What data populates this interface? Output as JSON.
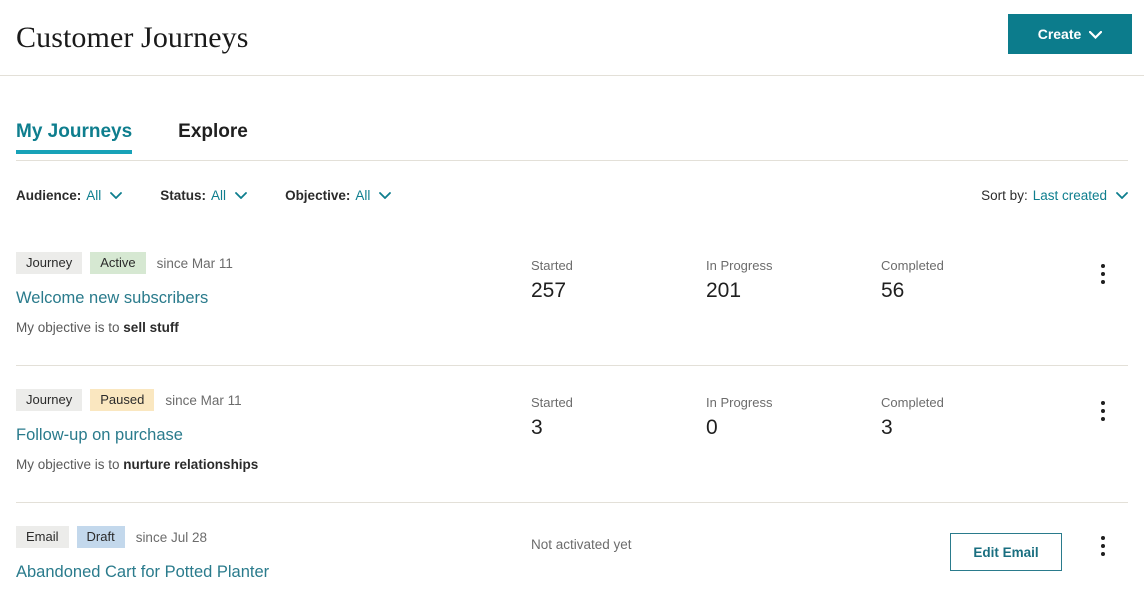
{
  "header": {
    "title": "Customer Journeys",
    "create_label": "Create",
    "create_caret": "∨",
    "create_color": "#0c7c8c"
  },
  "tabs": [
    {
      "label": "My Journeys",
      "active": true
    },
    {
      "label": "Explore",
      "active": false
    }
  ],
  "filters": [
    {
      "label": "Audience:",
      "value": "All",
      "caret": "∨"
    },
    {
      "label": "Status:",
      "value": "All",
      "caret": "∨"
    },
    {
      "label": "Objective:",
      "value": "All",
      "caret": "∨"
    }
  ],
  "sort": {
    "label": "Sort by:",
    "value": "Last created",
    "caret": "∨"
  },
  "stat_headers": {
    "started": "Started",
    "in_progress": "In Progress",
    "completed": "Completed"
  },
  "rows": [
    {
      "type_badge": "Journey",
      "status_badge": "Active",
      "status_kind": "active",
      "since": "since Mar 11",
      "title": "Welcome new subscribers",
      "objective_prefix": "My objective is to ",
      "objective": "sell stuff",
      "started": "257",
      "in_progress": "201",
      "completed": "56"
    },
    {
      "type_badge": "Journey",
      "status_badge": "Paused",
      "status_kind": "paused",
      "since": "since Mar 11",
      "title": "Follow-up on purchase",
      "objective_prefix": "My objective is to ",
      "objective": "nurture relationships",
      "started": "3",
      "in_progress": "0",
      "completed": "3"
    },
    {
      "type_badge": "Email",
      "status_badge": "Draft",
      "status_kind": "draft",
      "since": "since Jul 28",
      "title": "Abandoned Cart for Potted Planter",
      "not_activated": "Not activated yet",
      "edit_label": "Edit Email"
    }
  ]
}
